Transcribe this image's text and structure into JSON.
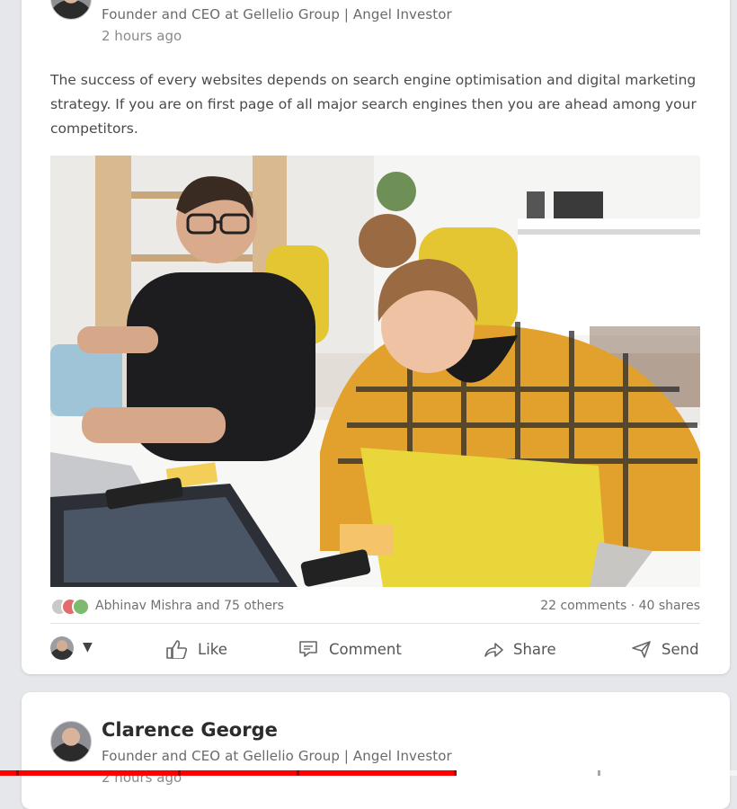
{
  "post1": {
    "subtitle": "Founder and CEO at Gellelio Group | Angel Investor",
    "timestamp": "2 hours ago",
    "text": "The success of every websites depends on search engine optimisation and digital marketing strategy. If you are on first page of all major search engines then you are ahead among your competitors.",
    "image_alt": "Two people laughing at a table with laptops",
    "reactions_text": "Abhinav Mishra and 75 others",
    "stats_text": "22 comments · 40 shares",
    "actions": {
      "like": "Like",
      "comment": "Comment",
      "share": "Share",
      "send": "Send"
    }
  },
  "post2": {
    "author": "Clarence George",
    "subtitle": "Founder and CEO at Gellelio Group | Angel Investor",
    "timestamp": "2 hours ago"
  },
  "video_progress": 0.62,
  "colors": {
    "progress_red": "#ff0000",
    "card_bg": "#ffffff",
    "page_bg": "#e6e7ea",
    "laptop_yellow": "#e8d63a",
    "shirt_plaid": "#e2a12c"
  }
}
